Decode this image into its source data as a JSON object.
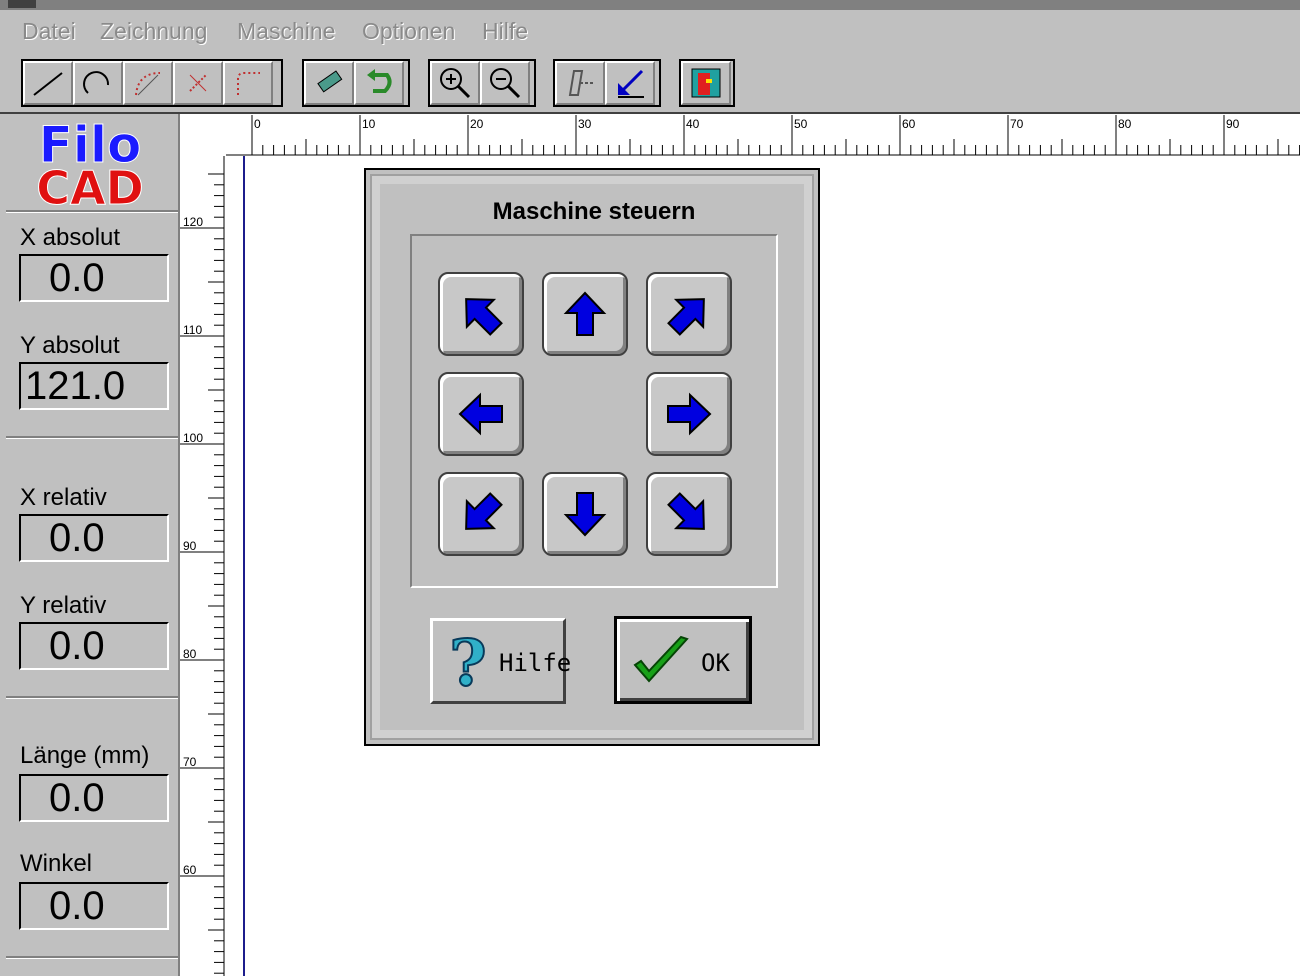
{
  "menu": [
    "Datei",
    "Zeichnung",
    "Maschine",
    "Optionen",
    "Hilfe"
  ],
  "toolbar": {
    "tools": [
      "line-tool-icon",
      "arc-tool-icon",
      "dotted-arc-tool-icon",
      "point-tool-icon",
      "corner-tool-icon",
      "erase-tool-icon",
      "undo-tool-icon",
      "zoom-in-icon",
      "zoom-out-icon",
      "machine-tool-icon",
      "origin-tool-icon",
      "exit-icon"
    ]
  },
  "logo": {
    "line1": "Filo",
    "line2": "CAD",
    "color1": "#1a1aff",
    "color2": "#e01010"
  },
  "sidebar": {
    "fields": [
      {
        "label": "X absolut",
        "value": "0.0"
      },
      {
        "label": "Y absolut",
        "value": "121.0"
      },
      {
        "label": "X  relativ",
        "value": "0.0"
      },
      {
        "label": "Y  relativ",
        "value": "0.0"
      },
      {
        "label": "Länge (mm)",
        "value": "0.0"
      },
      {
        "label": "Winkel",
        "value": "0.0"
      }
    ]
  },
  "rulers": {
    "horizontal": [
      "0",
      "10",
      "20",
      "30",
      "40",
      "50",
      "60",
      "70",
      "80",
      "90"
    ],
    "vertical": [
      "120",
      "110",
      "100",
      "90",
      "80",
      "70",
      "60"
    ]
  },
  "dialog": {
    "title": "Maschine steuern",
    "arrow_color": "#0000e0",
    "help_label": "Hilfe",
    "ok_label": "OK"
  }
}
